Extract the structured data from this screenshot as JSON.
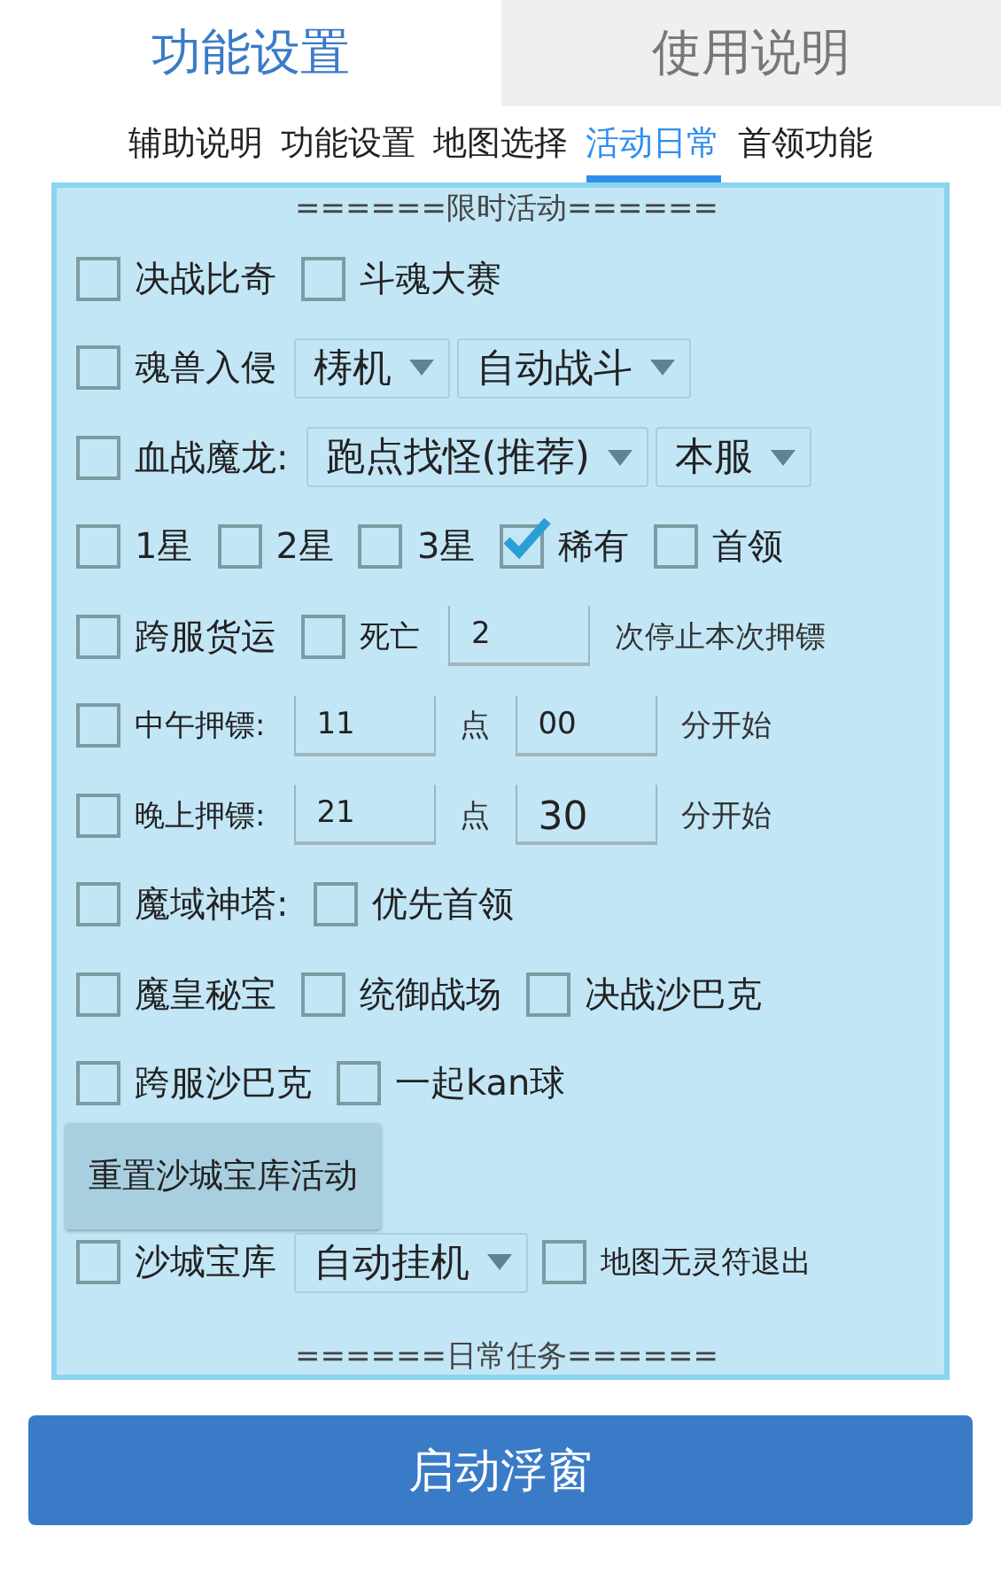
{
  "top_tabs": [
    {
      "label": "功能设置",
      "selected": true
    },
    {
      "label": "使用说明",
      "selected": false
    }
  ],
  "sub_tabs": [
    {
      "label": "辅助说明",
      "selected": false
    },
    {
      "label": "功能设置",
      "selected": false
    },
    {
      "label": "地图选择",
      "selected": false
    },
    {
      "label": "活动日常",
      "selected": true
    },
    {
      "label": "首领功能",
      "selected": false
    }
  ],
  "panel": {
    "header": "======限时活动======",
    "rows": [
      {
        "items": [
          {
            "kind": "checkbox",
            "label": "决战比奇",
            "checked": false
          },
          {
            "kind": "checkbox",
            "label": "斗魂大赛",
            "checked": false
          }
        ]
      },
      {
        "items": [
          {
            "kind": "checkbox",
            "label": "魂兽入侵",
            "checked": false
          },
          {
            "kind": "select",
            "value": "梼机"
          },
          {
            "kind": "select",
            "value": "自动战斗"
          }
        ]
      },
      {
        "items": [
          {
            "kind": "checkbox",
            "label": "血战魔龙:",
            "checked": false
          },
          {
            "kind": "select",
            "value": "跑点找怪(推荐)"
          },
          {
            "kind": "select",
            "value": "本服"
          }
        ]
      },
      {
        "items": [
          {
            "kind": "checkbox",
            "label": "1星",
            "checked": false
          },
          {
            "kind": "checkbox",
            "label": "2星",
            "checked": false
          },
          {
            "kind": "checkbox",
            "label": "3星",
            "checked": false
          },
          {
            "kind": "checkbox",
            "label": "稀有",
            "checked": true
          },
          {
            "kind": "checkbox",
            "label": "首领",
            "checked": false
          }
        ]
      },
      {
        "items": [
          {
            "kind": "checkbox",
            "label": "跨服货运",
            "checked": false
          },
          {
            "kind": "checkbox",
            "label": "死亡",
            "checked": false,
            "small": true
          },
          {
            "kind": "field",
            "value": "2"
          },
          {
            "kind": "text",
            "label": "次停止本次押镖"
          }
        ]
      },
      {
        "items": [
          {
            "kind": "checkbox",
            "label": "中午押镖:",
            "checked": false,
            "small": true
          },
          {
            "kind": "field",
            "value": "11"
          },
          {
            "kind": "text",
            "label": "点"
          },
          {
            "kind": "field",
            "value": "00"
          },
          {
            "kind": "text",
            "label": "分开始"
          }
        ]
      },
      {
        "items": [
          {
            "kind": "checkbox",
            "label": "晚上押镖:",
            "checked": false,
            "small": true
          },
          {
            "kind": "field",
            "value": "21"
          },
          {
            "kind": "text",
            "label": "点"
          },
          {
            "kind": "field",
            "value": "30",
            "large": true
          },
          {
            "kind": "text",
            "label": "分开始"
          }
        ]
      },
      {
        "items": [
          {
            "kind": "checkbox",
            "label": "魔域神塔:",
            "checked": false
          },
          {
            "kind": "checkbox",
            "label": "优先首领",
            "checked": false
          }
        ]
      },
      {
        "items": [
          {
            "kind": "checkbox",
            "label": "魔皇秘宝",
            "checked": false
          },
          {
            "kind": "checkbox",
            "label": "统御战场",
            "checked": false
          },
          {
            "kind": "checkbox",
            "label": "决战沙巴克",
            "checked": false
          }
        ]
      },
      {
        "items": [
          {
            "kind": "checkbox",
            "label": "跨服沙巴克",
            "checked": false
          },
          {
            "kind": "checkbox",
            "label": "一起kan球",
            "checked": false
          }
        ]
      },
      {
        "items": [
          {
            "kind": "button",
            "label": "重置沙城宝库活动"
          }
        ]
      },
      {
        "items": [
          {
            "kind": "checkbox",
            "label": "沙城宝库",
            "checked": false
          },
          {
            "kind": "select",
            "value": "自动挂机"
          },
          {
            "kind": "checkbox",
            "label": "地图无灵符退出",
            "checked": false,
            "small": true
          }
        ]
      }
    ],
    "footer": "======日常任务======"
  },
  "start_button": "启动浮窗"
}
